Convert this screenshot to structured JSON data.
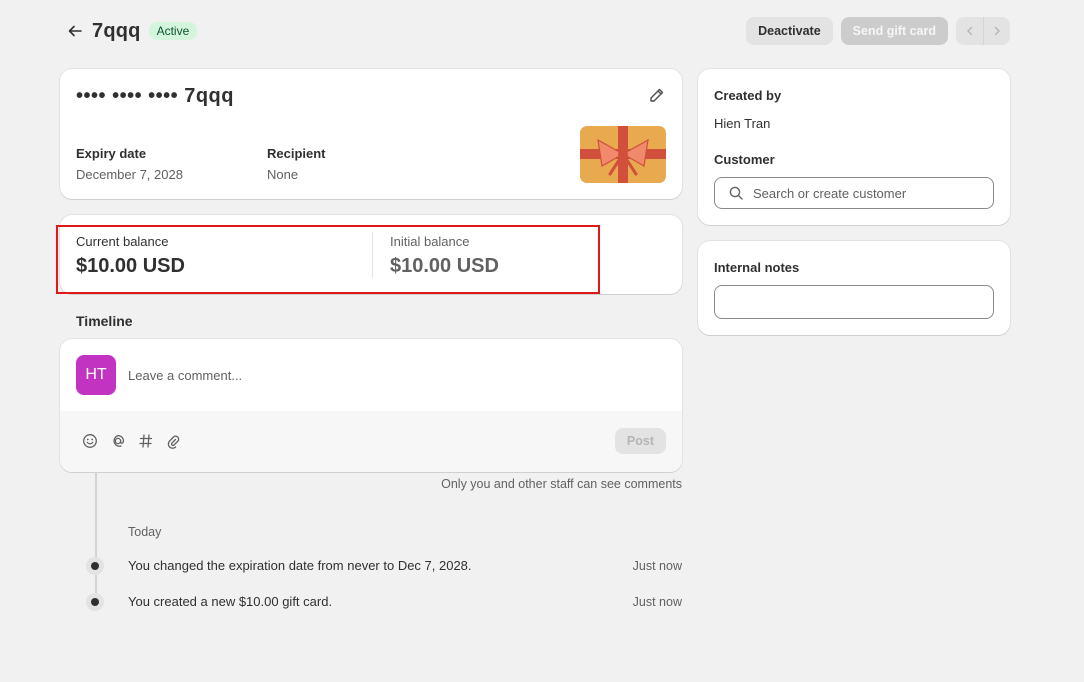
{
  "header": {
    "title": "7qqq",
    "status_badge": "Active",
    "deactivate_label": "Deactivate",
    "send_gift_card_label": "Send gift card"
  },
  "gift_card": {
    "masked_code": "•••• •••• •••• 7qqq",
    "expiry_label": "Expiry date",
    "expiry_value": "December 7, 2028",
    "recipient_label": "Recipient",
    "recipient_value": "None"
  },
  "balance": {
    "current_label": "Current balance",
    "current_value": "$10.00 USD",
    "initial_label": "Initial balance",
    "initial_value": "$10.00 USD"
  },
  "timeline": {
    "title": "Timeline",
    "avatar_initials": "HT",
    "comment_placeholder": "Leave a comment...",
    "post_label": "Post",
    "staff_note": "Only you and other staff can see comments",
    "day_label": "Today",
    "events": [
      {
        "text": "You changed the expiration date from never to Dec 7, 2028.",
        "time": "Just now"
      },
      {
        "text": "You created a new $10.00 gift card.",
        "time": "Just now"
      }
    ]
  },
  "sidebar": {
    "created_by_label": "Created by",
    "created_by_value": "Hien Tran",
    "customer_label": "Customer",
    "customer_search_placeholder": "Search or create customer",
    "internal_notes_label": "Internal notes",
    "internal_notes_value": ""
  },
  "colors": {
    "page_bg": "#f1f1f1",
    "badge_bg": "#d4f5dc",
    "avatar_bg": "#c233c2",
    "highlight_border": "#e01818",
    "gift_art_bg": "#e8a94f",
    "gift_ribbon": "#d0503c"
  },
  "icons": {
    "back": "arrow-left-icon",
    "edit": "pencil-icon",
    "search": "search-icon",
    "emoji": "smiley-icon",
    "mention": "at-sign-icon",
    "hashtag": "hashtag-icon",
    "attach": "paperclip-icon",
    "prev": "chevron-left-icon",
    "next": "chevron-right-icon"
  }
}
